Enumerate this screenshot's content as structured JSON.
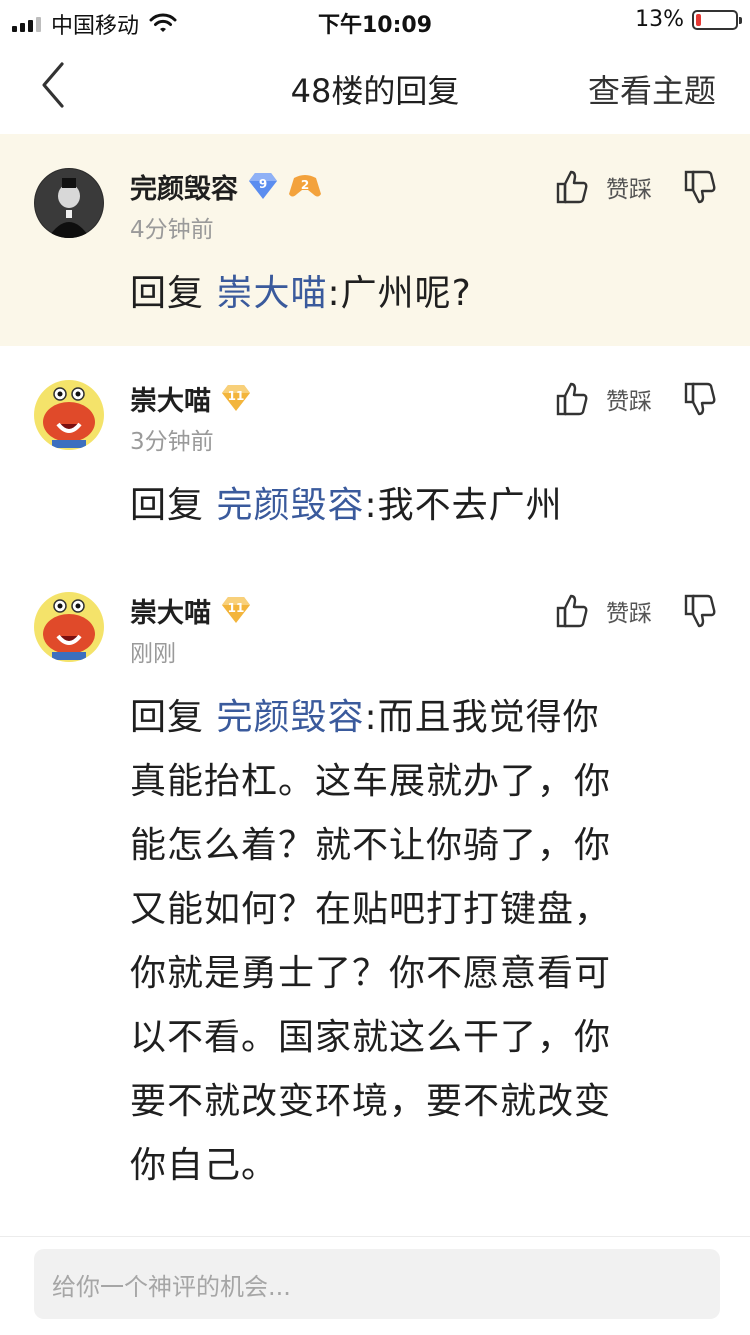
{
  "status_bar": {
    "carrier": "中国移动",
    "time": "下午10:09",
    "battery_text": "13%",
    "battery_level_percent": 13
  },
  "nav": {
    "title": "48楼的回复",
    "action": "查看主题"
  },
  "posts": [
    {
      "username": "完颜毁容",
      "level": "9",
      "game_level": "2",
      "time": "4分钟前",
      "reply_prefix": "回复",
      "mention": "崇大喵",
      "text": ":广州呢?",
      "vote_label": "赞踩"
    },
    {
      "username": "崇大喵",
      "level": "11",
      "time": "3分钟前",
      "reply_prefix": "回复",
      "mention": "完颜毁容",
      "text": ":我不去广州",
      "vote_label": "赞踩"
    },
    {
      "username": "崇大喵",
      "level": "11",
      "time": "刚刚",
      "reply_prefix": "回复",
      "mention": "完颜毁容",
      "text_lines": [
        ":而且我觉得你",
        "真能抬杠。这车展就办了，你",
        "能怎么着？就不让你骑了，你",
        "又能如何？在贴吧打打键盘，",
        "你就是勇士了？你不愿意看可",
        "以不看。国家就这么干了，你",
        "要不就改变环境，要不就改变",
        "你自己。"
      ],
      "vote_label": "赞踩"
    }
  ],
  "input": {
    "placeholder": "给你一个神评的机会..."
  },
  "colors": {
    "highlight_bg": "#fbf7e9",
    "mention": "#3a5a9c",
    "level_blue": "#5b8def",
    "level_gold": "#f3b53c",
    "battery_low": "#e63935"
  }
}
